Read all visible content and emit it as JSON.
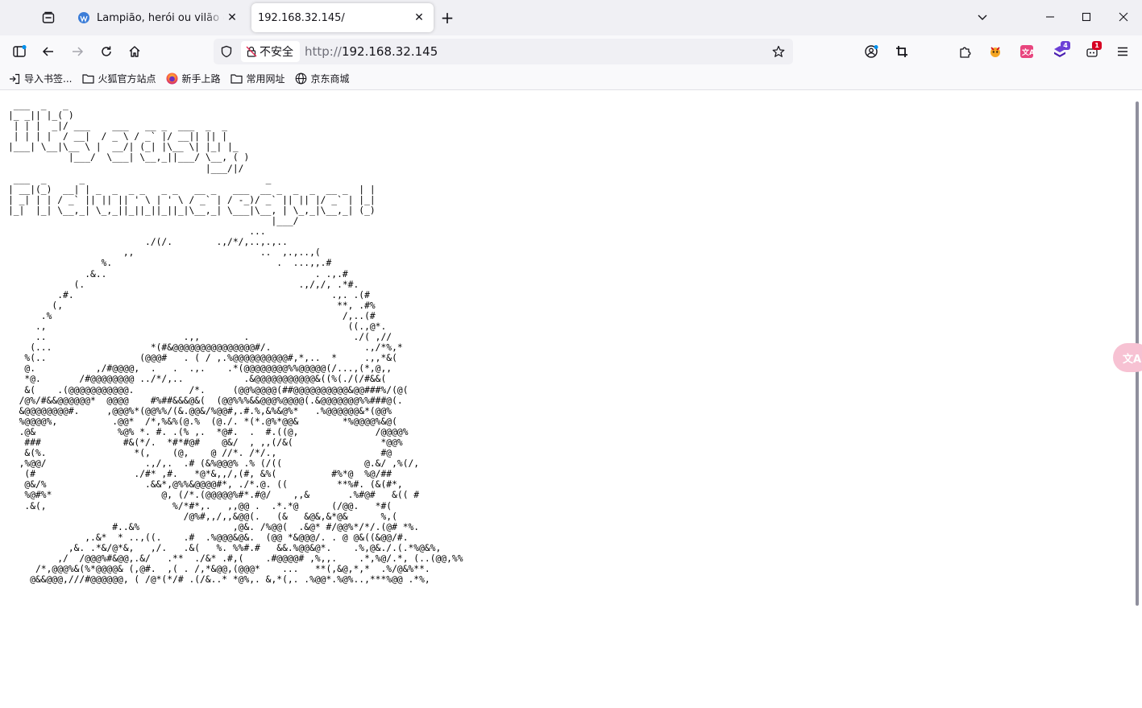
{
  "tabs": [
    {
      "title": "Lampião, herói ou vilão do Sertão?",
      "active": false
    },
    {
      "title": "192.168.32.145/",
      "active": true
    }
  ],
  "address_bar": {
    "security_label": "不安全",
    "url_scheme": "http://",
    "url_host": "192.168.32.145"
  },
  "bookmarks": [
    {
      "label": "导入书签...",
      "icon": "import-icon"
    },
    {
      "label": "火狐官方站点",
      "icon": "folder-icon"
    },
    {
      "label": "新手上路",
      "icon": "firefox-icon"
    },
    {
      "label": "常用网址",
      "icon": "folder-icon"
    },
    {
      "label": "京东商城",
      "icon": "globe-icon"
    }
  ],
  "extensions": {
    "badge_purple": "4",
    "badge_red": "1"
  },
  "translate_fab_label": "文A",
  "page": {
    "ascii_art": " ___  _   _\n|_ _|| |_( )\n | | |  _|/ ___    ___   __ _  ___  _  _\n | | | |  / __|  / _ \\ / _` |/ __|| || |\n|___| \\__|\\__ \\ |  __/| (_| |\\__ \\| |_| |_\n           |___/  \\___| \\__,_||___/ \\__, ( )\n                                    |___/|/\n ___  _      _                                 _\n| __|(_)  __| | _  _  _ _   _ _   __ _   ___  __ _  _  _  __ _  | |\n| _| | | / _` || || || ' \\ | ' \\ / _` | / -_)/ _` || || |/ _` | |_|\n|_|  |_| \\__,_| \\_,_||_||_||_||_|\\__,_| \\___|\\__, | \\_,_|\\__,_| (_)\n                                                |___/\n                                            ...\n                         ./(/.        .,/*/,..,.,..\n                     ,,                       ..  ,.,..,(\n                 %.                              .  ...,,.#\n              .&..                                      . .,.#\n            (.                                       .,/,/, .*#.\n         .#.                                               .,. .(#\n        (,                                                  **, .#%\n      .%                                                     /,..(#\n     .,                                                       ((.,@*.\n     ..                         .,,        .                   ./( ,//\n    (...                  *(#&@@@@@@@@@@@@@@@#/.                 .,/*%,*\n   %(..                 (@@@#   . ( / ,.%@@@@@@@@@@#,*,..  *     .,,*&(\n   @.           ,/#@@@@,  .   .  .,.    .*(@@@@@@@@%%@@@@@(/...,(*,@,,\n   *@.       /#@@@@@@@@ ../*/,..           .&@@@@@@@@@@@&((%(./(/#&&(\n   &(    .(@@@@@@@@@@@.          /*.     (@@%@@@@(##@@@@@@@@@@&@@###%/(@(\n  /@%/#&&@@@@@@*  @@@@    #%##&&&@&(  (@@%%%&&@@@%@@@@(.&@@@@@@@%%###@(.\n  &@@@@@@@@#.     ,@@@%*(@@%%/(&.@@&/%@@#,.#.%,&%&@%*   .%@@@@@@&*(@@%\n  %@@@@%,          .@@*  /*,%&%(@.%  (@./. *(*.@%*@@&        *%@@@@%&@(\n  .@&               %@% *. #. .(% ,.  *@#.  .  #.((@,              /@@@@%\n   ###               #&(*/.  *#*#@#    @&/  , ,,(/&(                *@@%\n   &(%.                *(,    (@,    @ //*. /*/.,                   #@\n  ,%@@/                  .,/,.  .# (&%@@@% .% (/((               @.&/ ,%(/,\n   (#                  ./#* ,#.   *@*&,,/,(#, &%(          #%*@  %@/##\n   @&/%                  .&&*,@%%&@@@@#*, ./*.@. ((         **%#. (&(#*,\n   %@#%*                    @, (/*.(@@@@@%#*.#@/    ,,&       .%#@#   &(( #\n   .&(,                       %/*#*,.   ,,@@ .  .*.*@      (/@@.   *#(\n                                /@%#,,/,,&@@(.   (&   &@&,&*@&      %,(\n                   #..&%                 ,@&. /%@@(  .&@* #/@@%*/*/.(@# *%.\n              ,.&*  * ..,((.    .#  .%@@@&@&.  (@@ *&@@@/. . @ @&((&@@/#.\n           ,&. .*&/@*&,   ,/.   .&(   %. %%#.#   &&.%@@&@*.    .%,@&./.(.*%@&%,\n         ,/  /@@@%#&@@,.&/   .**  ./&* .#,(    .#@@@@# ,%,,.    .*,%@/.*, (..(@@,%%\n     /*,@@@%&(%*@@@@& (,@#.  ,( . /,*&@@,(@@@*    ...   **(,&@,*,*  .%/@&%**.\n    @&&@@@,///#@@@@@@, ( /@*(*/# .(/&..* *@%,. &,*(,. .%@@*.%@%..,***%@@ .*%,"
  }
}
